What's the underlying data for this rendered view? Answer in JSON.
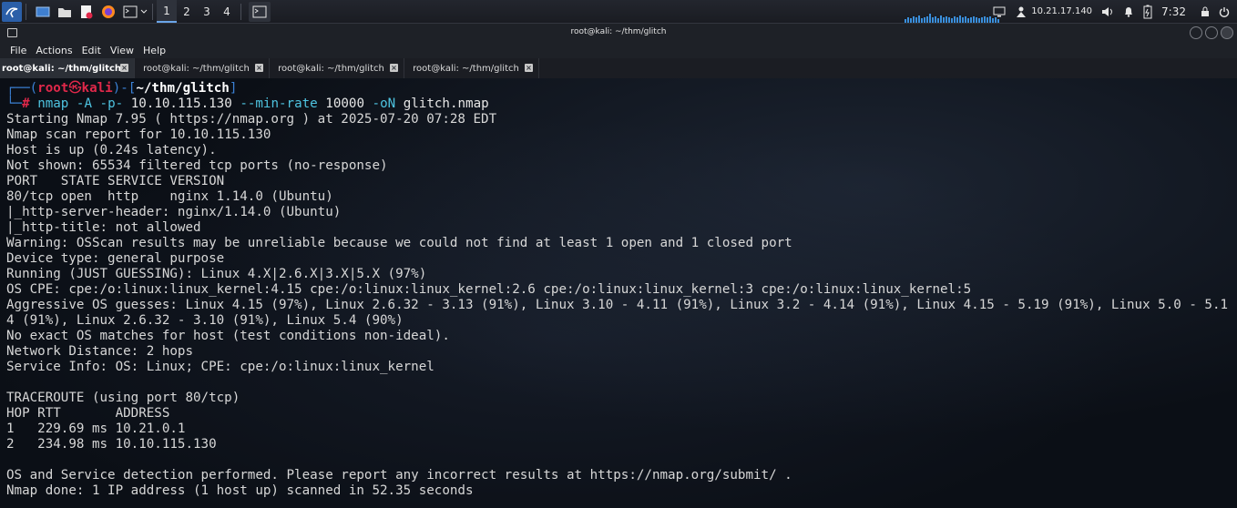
{
  "panel": {
    "workspaces": [
      "1",
      "2",
      "3",
      "4"
    ],
    "ip": "10.21.17.140",
    "time": "7:32",
    "graph_levels": [
      0.3,
      0.5,
      0.4,
      0.6,
      0.5,
      0.7,
      0.4,
      0.5,
      0.6,
      0.8,
      0.5,
      0.6,
      0.4,
      0.7,
      0.5,
      0.6,
      0.5,
      0.4,
      0.6,
      0.5,
      0.7,
      0.5,
      0.6,
      0.4,
      0.5,
      0.6,
      0.5,
      0.4,
      0.5,
      0.6,
      0.5,
      0.6,
      0.4,
      0.5,
      0.3
    ]
  },
  "window": {
    "title": "root@kali: ~/thm/glitch"
  },
  "menu": [
    "File",
    "Actions",
    "Edit",
    "View",
    "Help"
  ],
  "tabs": [
    {
      "label": "root@kali: ~/thm/glitch"
    },
    {
      "label": "root@kali: ~/thm/glitch"
    },
    {
      "label": "root@kali: ~/thm/glitch"
    },
    {
      "label": "root@kali: ~/thm/glitch"
    }
  ],
  "prompt": {
    "top_prefix": "┌──(",
    "user": "root",
    "skull": "㉿",
    "host": "kali",
    "mid": ")-[",
    "path": "~/thm/glitch",
    "end": "]",
    "bottom_prefix": "└─",
    "hash": "#",
    "cmd": "nmap",
    "opt1": "-A",
    "opt2": "-p-",
    "target": "10.10.115.130",
    "opt3": "--min-rate",
    "rate": "10000",
    "opt4": "-oN",
    "outfile": "glitch.nmap"
  },
  "output": [
    "Starting Nmap 7.95 ( https://nmap.org ) at 2025-07-20 07:28 EDT",
    "Nmap scan report for 10.10.115.130",
    "Host is up (0.24s latency).",
    "Not shown: 65534 filtered tcp ports (no-response)",
    "PORT   STATE SERVICE VERSION",
    "80/tcp open  http    nginx 1.14.0 (Ubuntu)",
    "|_http-server-header: nginx/1.14.0 (Ubuntu)",
    "|_http-title: not allowed",
    "Warning: OSScan results may be unreliable because we could not find at least 1 open and 1 closed port",
    "Device type: general purpose",
    "Running (JUST GUESSING): Linux 4.X|2.6.X|3.X|5.X (97%)",
    "OS CPE: cpe:/o:linux:linux_kernel:4.15 cpe:/o:linux:linux_kernel:2.6 cpe:/o:linux:linux_kernel:3 cpe:/o:linux:linux_kernel:5",
    "Aggressive OS guesses: Linux 4.15 (97%), Linux 2.6.32 - 3.13 (91%), Linux 3.10 - 4.11 (91%), Linux 3.2 - 4.14 (91%), Linux 4.15 - 5.19 (91%), Linux 5.0 - 5.1",
    "4 (91%), Linux 2.6.32 - 3.10 (91%), Linux 5.4 (90%)",
    "No exact OS matches for host (test conditions non-ideal).",
    "Network Distance: 2 hops",
    "Service Info: OS: Linux; CPE: cpe:/o:linux:linux_kernel",
    "",
    "TRACEROUTE (using port 80/tcp)",
    "HOP RTT       ADDRESS",
    "1   229.69 ms 10.21.0.1",
    "2   234.98 ms 10.10.115.130",
    "",
    "OS and Service detection performed. Please report any incorrect results at https://nmap.org/submit/ .",
    "Nmap done: 1 IP address (1 host up) scanned in 52.35 seconds"
  ]
}
